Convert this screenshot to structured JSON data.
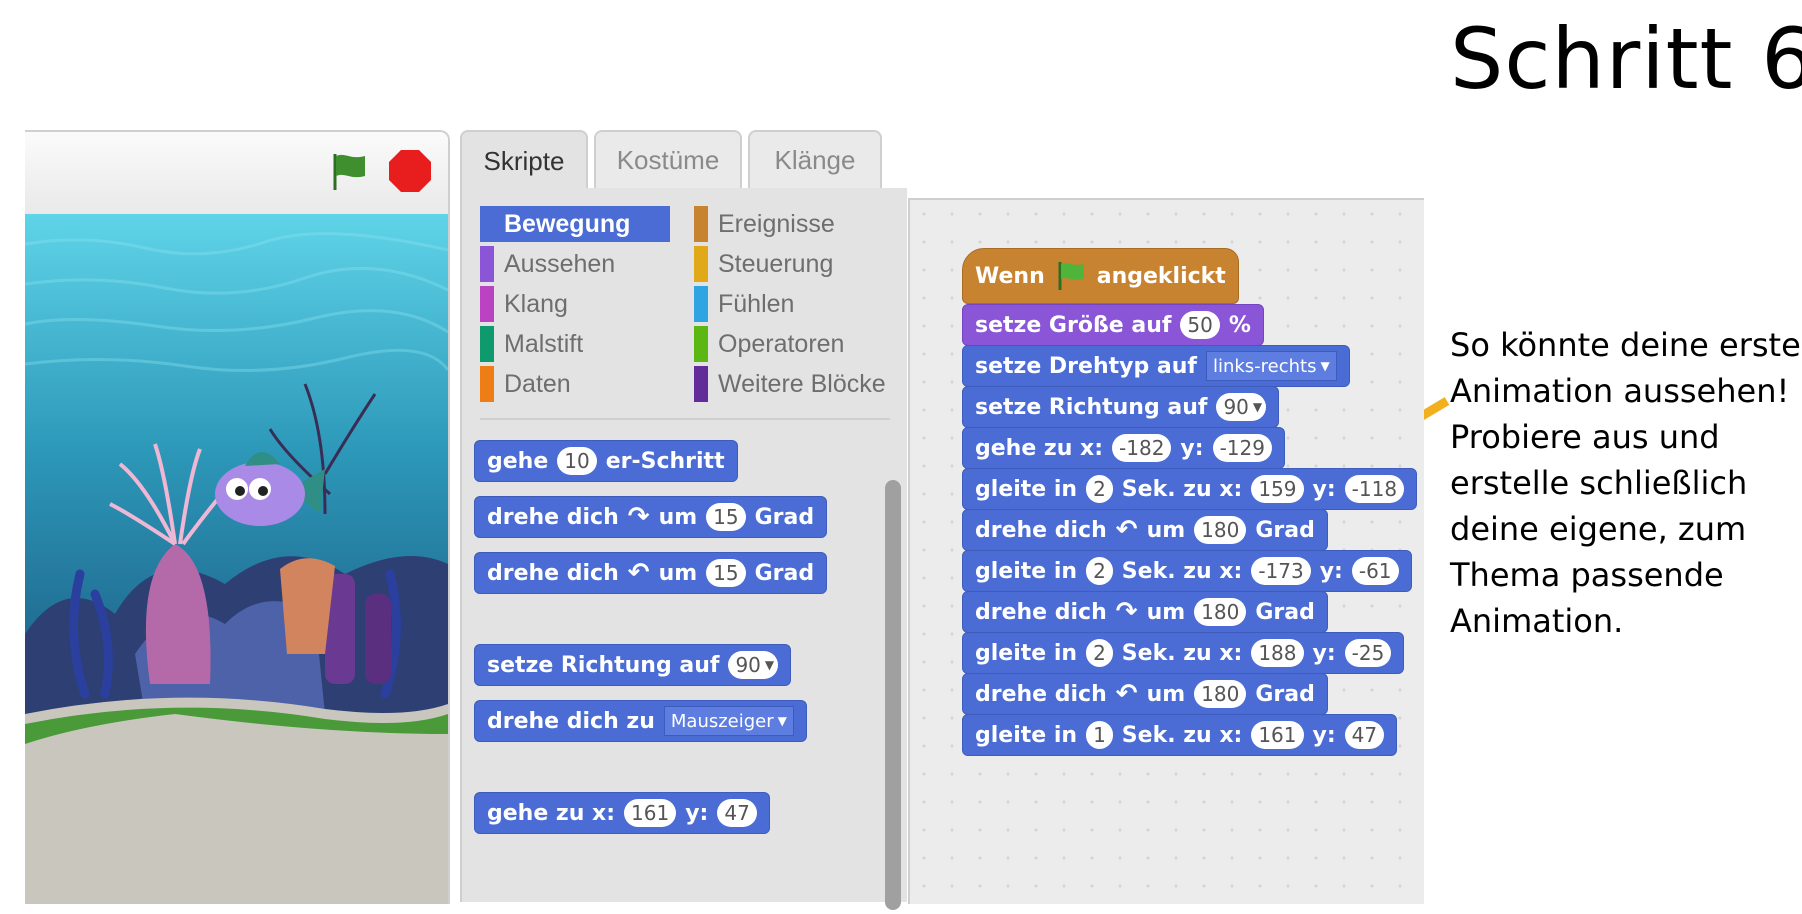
{
  "slide": {
    "title": "Schritt 6",
    "note_lines": [
      "So könnte deine erste",
      "Animation aussehen!",
      "Probiere aus und",
      "erstelle schließlich",
      "deine eigene, zum",
      "Thema passende",
      "Animation."
    ],
    "arrow_color": "#f2b01e"
  },
  "stage": {
    "green_flag_icon": "green-flag-icon",
    "stop_icon": "stop-sign-icon",
    "stop_color": "#e81e1e",
    "flag_color": "#3f8f2f"
  },
  "tabs": [
    "Skripte",
    "Kostüme",
    "Klänge"
  ],
  "categories": [
    {
      "label": "Bewegung",
      "color": "#4a6cd4"
    },
    {
      "label": "Ereignisse",
      "color": "#c88330"
    },
    {
      "label": "Aussehen",
      "color": "#8a55d7"
    },
    {
      "label": "Steuerung",
      "color": "#e1a91a"
    },
    {
      "label": "Klang",
      "color": "#bb42c3"
    },
    {
      "label": "Fühlen",
      "color": "#2ca5e2"
    },
    {
      "label": "Malstift",
      "color": "#0e9a6c"
    },
    {
      "label": "Operatoren",
      "color": "#5cb712"
    },
    {
      "label": "Daten",
      "color": "#ee7d16"
    },
    {
      "label": "Weitere Blöcke",
      "color": "#632d99"
    }
  ],
  "palette_blocks": {
    "move": {
      "a": "gehe",
      "steps": "10",
      "b": "er-Schritt"
    },
    "turn_right": {
      "a": "drehe dich",
      "b": "um",
      "deg": "15",
      "c": "Grad"
    },
    "turn_left": {
      "a": "drehe dich",
      "b": "um",
      "deg": "15",
      "c": "Grad"
    },
    "point_dir": {
      "a": "setze Richtung auf",
      "val": "90"
    },
    "point_towards": {
      "a": "drehe dich zu",
      "val": "Mauszeiger"
    },
    "goto_xy": {
      "a": "gehe zu x:",
      "x": "161",
      "b": "y:",
      "y": "47"
    }
  },
  "script": {
    "hat": {
      "a": "Wenn",
      "b": "angeklickt"
    },
    "size": {
      "a": "setze Größe auf",
      "val": "50",
      "b": "%"
    },
    "rotstyle": {
      "a": "setze Drehtyp auf",
      "val": "links-rechts"
    },
    "dir": {
      "a": "setze Richtung auf",
      "val": "90"
    },
    "goto": {
      "a": "gehe zu x:",
      "x": "-182",
      "b": "y:",
      "y": "-129"
    },
    "glide1": {
      "a": "gleite in",
      "t": "2",
      "b": "Sek. zu x:",
      "x": "159",
      "c": "y:",
      "y": "-118"
    },
    "turn1": {
      "a": "drehe dich",
      "b": "um",
      "deg": "180",
      "c": "Grad"
    },
    "glide2": {
      "a": "gleite in",
      "t": "2",
      "b": "Sek. zu x:",
      "x": "-173",
      "c": "y:",
      "y": "-61"
    },
    "turn2": {
      "a": "drehe dich",
      "b": "um",
      "deg": "180",
      "c": "Grad"
    },
    "glide3": {
      "a": "gleite in",
      "t": "2",
      "b": "Sek. zu x:",
      "x": "188",
      "c": "y:",
      "y": "-25"
    },
    "turn3": {
      "a": "drehe dich",
      "b": "um",
      "deg": "180",
      "c": "Grad"
    },
    "glide4": {
      "a": "gleite in",
      "t": "1",
      "b": "Sek. zu x:",
      "x": "161",
      "c": "y:",
      "y": "47"
    }
  }
}
